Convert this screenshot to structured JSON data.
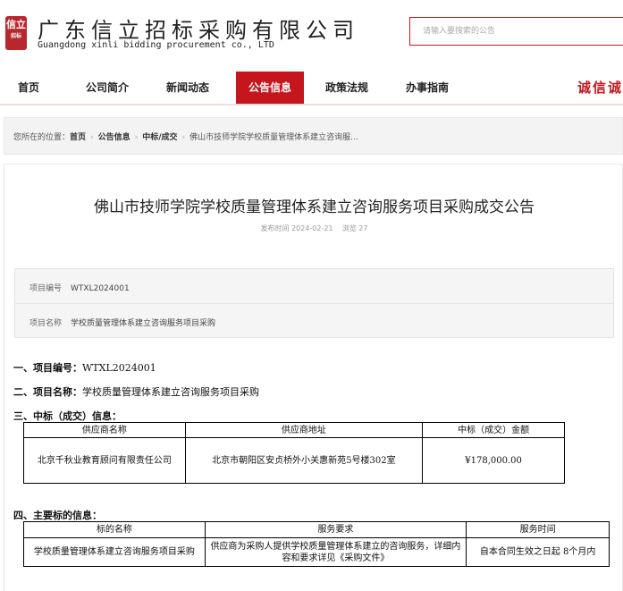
{
  "header": {
    "logo_text": "信立",
    "logo_sub": "招标",
    "brand_cn": "广东信立招标采购有限公司",
    "brand_en": "Guangdong xinli bidding procurement co., LTD",
    "search_placeholder": "请输入要搜索的公告"
  },
  "nav": {
    "items": [
      {
        "label": "首页"
      },
      {
        "label": "公司简介"
      },
      {
        "label": "新闻动态"
      },
      {
        "label": "公告信息"
      },
      {
        "label": "政策法规"
      },
      {
        "label": "办事指南"
      }
    ],
    "active_index": 3,
    "slogan": "诚信诚",
    "accent_color": "#c4161c"
  },
  "breadcrumb": {
    "prefix": "您所在的位置：",
    "items": [
      "首页",
      "公告信息",
      "中标/成交",
      "佛山市技师学院学校质量管理体系建立咨询服..."
    ]
  },
  "article": {
    "title": "佛山市技师学院学校质量管理体系建立咨询服务项目采购成交公告",
    "publish_label": "发布时间",
    "publish_date": "2024-02-21",
    "views_label": "浏览",
    "views": "27",
    "info": {
      "project_no_label": "项目编号",
      "project_no": "WTXL2024001",
      "project_name_label": "项目名称",
      "project_name": "学校质量管理体系建立咨询服务项目采购"
    },
    "sections": {
      "s1_label": "一、项目编号：",
      "s1_value": "WTXL2024001",
      "s2_label": "二、项目名称：",
      "s2_value": "学校质量管理体系建立咨询服务项目采购",
      "s3_label": "三、中标（成交）信息：",
      "s4_label": "四、主要标的信息："
    },
    "award_table": {
      "headers": [
        "供应商名称",
        "供应商地址",
        "中标（成交）金额"
      ],
      "rows": [
        [
          "北京千秋业教育顾问有限责任公司",
          "北京市朝阳区安贞桥外小关惠新苑5号楼302室",
          "¥178,000.00"
        ]
      ]
    },
    "item_table": {
      "headers": [
        "标的名称",
        "服务要求",
        "服务时间"
      ],
      "rows": [
        [
          "学校质量管理体系建立咨询服务项目采购",
          "供应商为采购人提供学校质量管理体系建立的咨询服务，详细内容和要求详见《采购文件》",
          "自本合同生效之日起 8个月内"
        ]
      ]
    }
  }
}
